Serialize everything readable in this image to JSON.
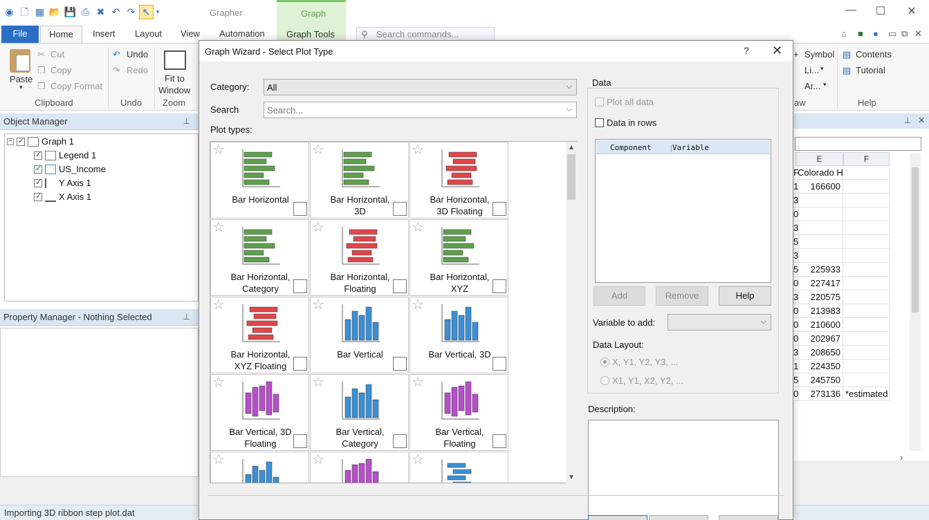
{
  "app": {
    "title": "Grapher",
    "context_group": "Graph",
    "window_controls": [
      "—",
      "☐",
      "✕"
    ]
  },
  "tabs": {
    "file": "File",
    "home": "Home",
    "insert": "Insert",
    "layout": "Layout",
    "view": "View",
    "automation": "Automation",
    "graph_tools": "Graph Tools",
    "search_placeholder": "Search commands..."
  },
  "ribbon": {
    "paste": "Paste",
    "cut": "Cut",
    "copy": "Copy",
    "copy_format": "Copy Format",
    "clipboard_group": "Clipboard",
    "undo": "Undo",
    "redo": "Redo",
    "undo_group": "Undo",
    "fit_line1": "Fit to",
    "fit_line2": "Window",
    "zoom_group": "Zoom",
    "symbol": "Symbol",
    "li": "Li...",
    "ar": "Ar...",
    "aw_group": "aw",
    "contents": "Contents",
    "tutorial": "Tutorial",
    "help_group": "Help"
  },
  "object_manager": {
    "title": "Object Manager",
    "pin": "ᵾ",
    "items": [
      {
        "label": "Graph 1"
      },
      {
        "label": "Legend 1"
      },
      {
        "label": "US_Income"
      },
      {
        "label": "Y Axis 1"
      },
      {
        "label": "X Axis 1"
      }
    ]
  },
  "property_manager": {
    "title": "Property Manager - Nothing Selected"
  },
  "status": {
    "text": "Importing 3D ribbon step plot.dat"
  },
  "sheet": {
    "col_e": "E",
    "col_f": "F",
    "rows": [
      {
        "d": "F",
        "e": "Colorado H",
        "f": ""
      },
      {
        "d": "1",
        "e": "166600",
        "f": ""
      },
      {
        "d": "3",
        "e": "",
        "f": ""
      },
      {
        "d": "0",
        "e": "",
        "f": ""
      },
      {
        "d": "3",
        "e": "",
        "f": ""
      },
      {
        "d": "5",
        "e": "",
        "f": ""
      },
      {
        "d": "3",
        "e": "",
        "f": ""
      },
      {
        "d": "5",
        "e": "225933",
        "f": ""
      },
      {
        "d": "0",
        "e": "227417",
        "f": ""
      },
      {
        "d": "3",
        "e": "220575",
        "f": ""
      },
      {
        "d": "0",
        "e": "213983",
        "f": ""
      },
      {
        "d": "0",
        "e": "210600",
        "f": ""
      },
      {
        "d": "0",
        "e": "202967",
        "f": ""
      },
      {
        "d": "3",
        "e": "208650",
        "f": ""
      },
      {
        "d": "1",
        "e": "224350",
        "f": ""
      },
      {
        "d": "5",
        "e": "245750",
        "f": ""
      },
      {
        "d": "0",
        "e": "273136",
        "f": "*estimated"
      }
    ]
  },
  "dialog": {
    "title": "Graph Wizard - Select Plot Type",
    "help": "?",
    "close": "✕",
    "category_label": "Category:",
    "category_value": "All",
    "search_label": "Search",
    "search_placeholder": "Search...",
    "plot_types_label": "Plot types:",
    "tiles": [
      {
        "l1": "Bar Horizontal",
        "l2": "",
        "icon": "bar-horizontal-icon",
        "color": "#5fa04e"
      },
      {
        "l1": "Bar Horizontal,",
        "l2": "3D",
        "icon": "bar-horizontal-3d-icon",
        "color": "#5fa04e"
      },
      {
        "l1": "Bar Horizontal,",
        "l2": "3D Floating",
        "icon": "bar-horizontal-3d-floating-icon",
        "color": "#e0474a"
      },
      {
        "l1": "Bar Horizontal,",
        "l2": "Category",
        "icon": "bar-horizontal-category-icon",
        "color": "#5fa04e"
      },
      {
        "l1": "Bar Horizontal,",
        "l2": "Floating",
        "icon": "bar-horizontal-floating-icon",
        "color": "#e0474a"
      },
      {
        "l1": "Bar Horizontal,",
        "l2": "XYZ",
        "icon": "bar-horizontal-xyz-icon",
        "color": "#5fa04e"
      },
      {
        "l1": "Bar Horizontal,",
        "l2": "XYZ Floating",
        "icon": "bar-horizontal-xyz-floating-icon",
        "color": "#e0474a"
      },
      {
        "l1": "Bar Vertical",
        "l2": "",
        "icon": "bar-vertical-icon",
        "color": "#3d8fd4"
      },
      {
        "l1": "Bar Vertical, 3D",
        "l2": "",
        "icon": "bar-vertical-3d-icon",
        "color": "#3d8fd4"
      },
      {
        "l1": "Bar Vertical, 3D",
        "l2": "Floating",
        "icon": "bar-vertical-3d-floating-icon",
        "color": "#b64fc8"
      },
      {
        "l1": "Bar Vertical,",
        "l2": "Category",
        "icon": "bar-vertical-category-icon",
        "color": "#3d8fd4"
      },
      {
        "l1": "Bar Vertical,",
        "l2": "Floating",
        "icon": "bar-vertical-floating-icon",
        "color": "#b64fc8"
      },
      {
        "l1": "",
        "l2": "",
        "icon": "bar-vertical-xyz-icon",
        "color": "#3d8fd4"
      },
      {
        "l1": "",
        "l2": "",
        "icon": "bar-vertical-xyz-floating-icon",
        "color": "#b64fc8"
      },
      {
        "l1": "",
        "l2": "",
        "icon": "box-whisker-icon",
        "color": "#3d8fd4"
      }
    ],
    "data_group": "Data",
    "plot_all_data": "Plot all data",
    "data_in_rows": "Data in rows",
    "col_component": "Component",
    "col_variable": "Variable",
    "add": "Add",
    "remove": "Remove",
    "help_btn": "Help",
    "variable_to_add": "Variable to add:",
    "data_layout": "Data Layout:",
    "layout_opt1": "X, Y1, Y2, Y3, ...",
    "layout_opt2": "X1, Y1, X2, Y2, ...",
    "description": "Description:"
  }
}
